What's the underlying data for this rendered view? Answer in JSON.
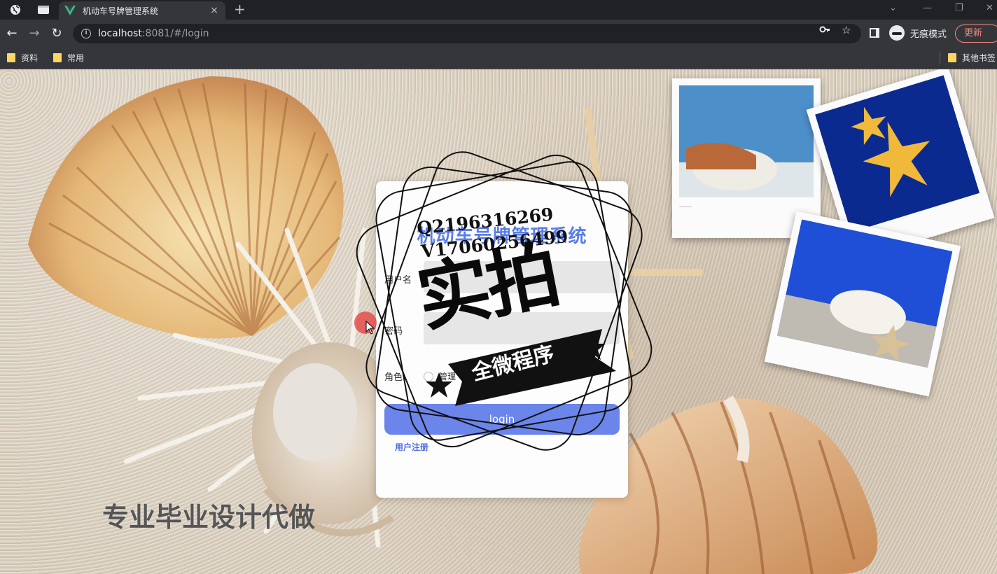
{
  "browser": {
    "tab_title": "机动车号牌管理系统",
    "tab_close": "×",
    "new_tab": "+",
    "url_host": "localhost",
    "url_rest": ":8081/#/login",
    "incognito_label": "无痕模式",
    "update_label": "更新",
    "bookmarks": [
      "资料",
      "常用"
    ],
    "other_bookmarks": "其他书签"
  },
  "login": {
    "title": "机动车号牌管理系统",
    "username_label": "用户名",
    "password_label": "密码",
    "role_label": "角色",
    "role_option": "管理",
    "login_button": "login",
    "register_link": "用户注册"
  },
  "watermark": {
    "contact_q": "Q2196316269",
    "contact_v": "V17060256499",
    "big_text": "实拍",
    "ribbon_text": "全微程序",
    "bottom_text": "专业毕业设计代做"
  },
  "colors": {
    "accent": "#6b85ea",
    "title": "#5a7de8",
    "link": "#4f6ce0",
    "update": "#f28b82"
  }
}
